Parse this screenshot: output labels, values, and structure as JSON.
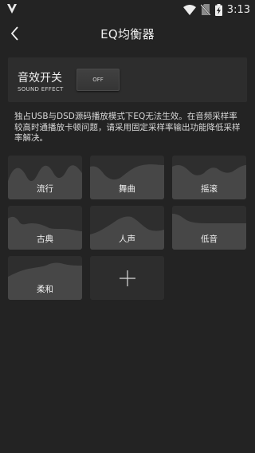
{
  "status_bar": {
    "time": "3:13",
    "icons": [
      "v-logo-icon",
      "wifi-icon",
      "no-sim-icon",
      "battery-charging-icon"
    ]
  },
  "toolbar": {
    "title": "EQ均衡器",
    "back_icon": "back-chevron-icon"
  },
  "sound_effect": {
    "label_cn": "音效开关",
    "label_en": "SOUND EFFECT",
    "toggle_label": "OFF"
  },
  "notice": "独占USB与DSD源码播放模式下EQ无法生效。在音频采样率较高时通播放卡顿问题，请采用固定采样率输出功能降低采样率解决。",
  "presets": [
    {
      "name": "流行"
    },
    {
      "name": "舞曲"
    },
    {
      "name": "摇滚"
    },
    {
      "name": "古典"
    },
    {
      "name": "人声"
    },
    {
      "name": "低音"
    },
    {
      "name": "柔和"
    }
  ],
  "add_tile": {
    "icon": "plus-icon"
  },
  "colors": {
    "background": "#232323",
    "panel": "#2d2d2d",
    "tile": "#2e2e2e",
    "curve_fill": "#4a4a4a"
  }
}
